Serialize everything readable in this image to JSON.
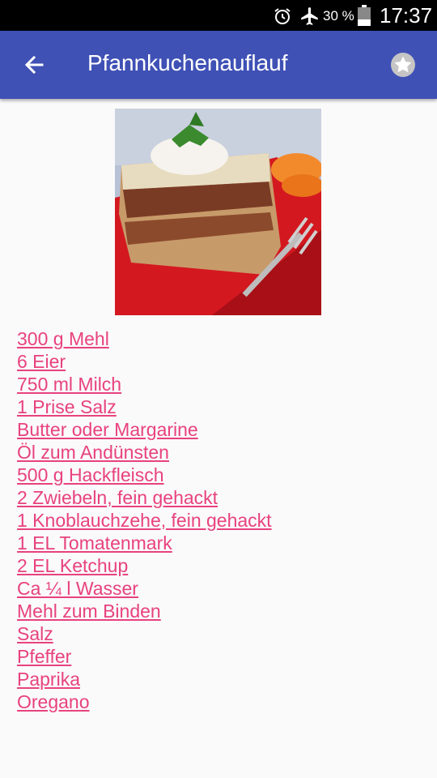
{
  "status_bar": {
    "battery_percent": "30 %",
    "time": "17:37",
    "icons": [
      "alarm-icon",
      "airplane-mode-icon",
      "battery-icon"
    ]
  },
  "app_bar": {
    "title": "Pfannkuchenauflauf",
    "back_icon": "arrow-back-icon",
    "favorite_icon": "star-icon",
    "color": "#3f51b5"
  },
  "recipe": {
    "image": "dish-photo",
    "link_color": "#e8427e",
    "ingredients": [
      "300 g Mehl",
      "6 Eier",
      "750 ml Milch",
      "1 Prise Salz",
      "Butter oder Margarine",
      "Öl zum Andünsten",
      "500 g Hackfleisch",
      "2 Zwiebeln, fein gehackt",
      "1 Knoblauchzehe, fein gehackt",
      "1 EL Tomatenmark",
      "2 EL Ketchup",
      "Ca ¼ l Wasser",
      "Mehl zum Binden",
      "Salz",
      "Pfeffer",
      "Paprika",
      "Oregano"
    ]
  }
}
